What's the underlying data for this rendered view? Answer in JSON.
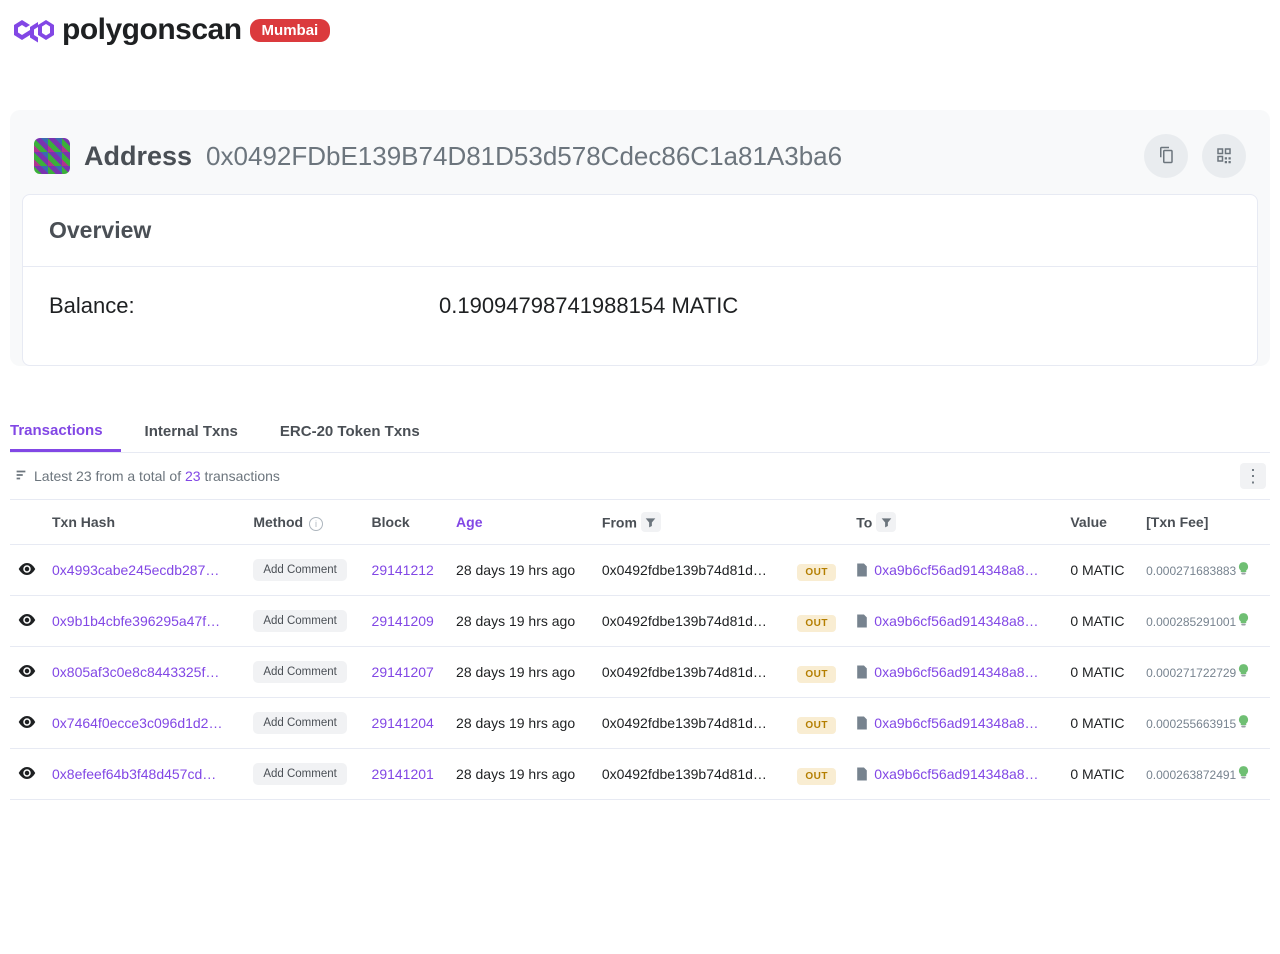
{
  "header": {
    "logo_text": "polygonscan",
    "network_badge": "Mumbai"
  },
  "address": {
    "label": "Address",
    "hash": "0x0492FDbE139B74D81D53d578Cdec86C1a81A3ba6"
  },
  "overview": {
    "title": "Overview",
    "balance_label": "Balance:",
    "balance_value": "0.19094798741988154 MATIC"
  },
  "tabs": [
    {
      "id": "tx",
      "label": "Transactions",
      "active": true
    },
    {
      "id": "int",
      "label": "Internal Txns",
      "active": false
    },
    {
      "id": "erc20",
      "label": "ERC-20 Token Txns",
      "active": false
    }
  ],
  "summary": {
    "prefix": "Latest 23 from a total of ",
    "link": "23",
    "suffix": " transactions"
  },
  "table": {
    "headers": {
      "txn": "Txn Hash",
      "method": "Method",
      "block": "Block",
      "age": "Age",
      "from": "From",
      "to": "To",
      "value": "Value",
      "fee": "[Txn Fee]"
    },
    "rows": [
      {
        "hash": "0x4993cabe245ecdb287…",
        "method": "Add Comment",
        "block": "29141212",
        "age": "28 days 19 hrs ago",
        "from": "0x0492fdbe139b74d81d…",
        "dir": "OUT",
        "to": "0xa9b6cf56ad914348a8…",
        "value": "0 MATIC",
        "fee": "0.000271683883"
      },
      {
        "hash": "0x9b1b4cbfe396295a47f…",
        "method": "Add Comment",
        "block": "29141209",
        "age": "28 days 19 hrs ago",
        "from": "0x0492fdbe139b74d81d…",
        "dir": "OUT",
        "to": "0xa9b6cf56ad914348a8…",
        "value": "0 MATIC",
        "fee": "0.000285291001"
      },
      {
        "hash": "0x805af3c0e8c8443325f…",
        "method": "Add Comment",
        "block": "29141207",
        "age": "28 days 19 hrs ago",
        "from": "0x0492fdbe139b74d81d…",
        "dir": "OUT",
        "to": "0xa9b6cf56ad914348a8…",
        "value": "0 MATIC",
        "fee": "0.000271722729"
      },
      {
        "hash": "0x7464f0ecce3c096d1d2…",
        "method": "Add Comment",
        "block": "29141204",
        "age": "28 days 19 hrs ago",
        "from": "0x0492fdbe139b74d81d…",
        "dir": "OUT",
        "to": "0xa9b6cf56ad914348a8…",
        "value": "0 MATIC",
        "fee": "0.000255663915"
      },
      {
        "hash": "0x8efeef64b3f48d457cd…",
        "method": "Add Comment",
        "block": "29141201",
        "age": "28 days 19 hrs ago",
        "from": "0x0492fdbe139b74d81d…",
        "dir": "OUT",
        "to": "0xa9b6cf56ad914348a8…",
        "value": "0 MATIC",
        "fee": "0.000263872491"
      }
    ]
  }
}
